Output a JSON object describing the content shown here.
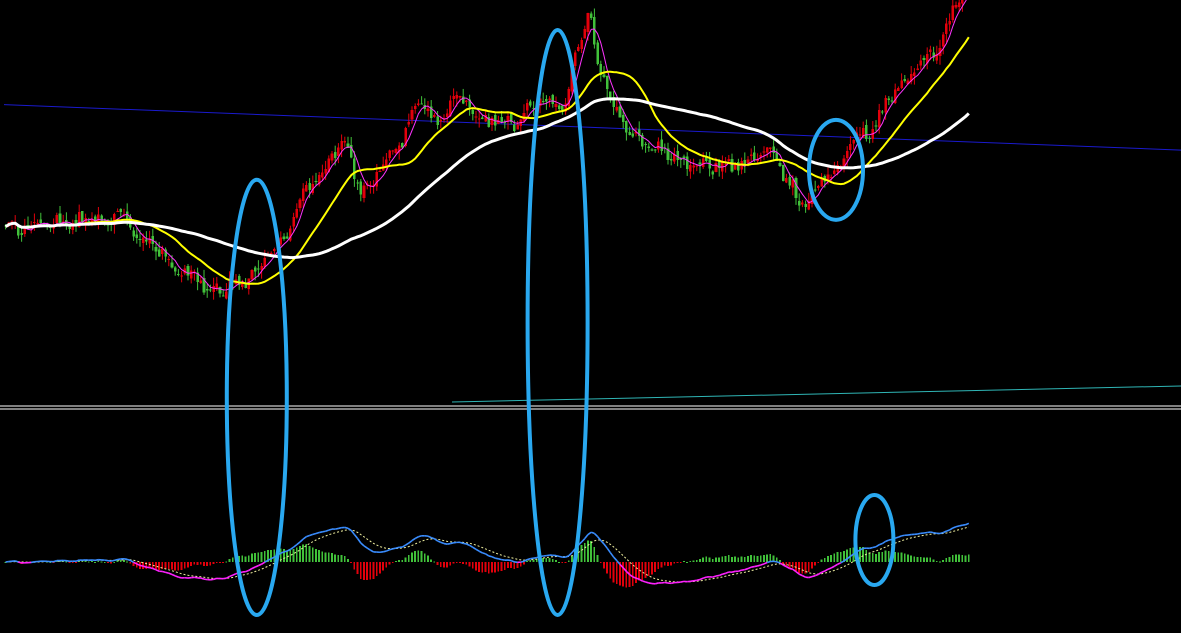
{
  "colors": {
    "background": "#000000",
    "up": "#e3000b",
    "down": "#41c13a",
    "ma_fast": "#ff33ff",
    "ma_mid": "#ffff00",
    "ma_slow": "#ffffff",
    "trendline_top": "#1a1acd",
    "trendline_bottom": "#2fb5b5",
    "separator": "#ffffff",
    "diff_line": "#3a8dff",
    "diff_line_below": "#ff22ff",
    "dea_line": "#f0f0a0",
    "highlight": "#29a8f0"
  },
  "chart_data": [
    {
      "type": "candlestick",
      "panel": "price",
      "title": "",
      "xlabel": "",
      "ylabel": "",
      "grid": false,
      "ylim": [
        0,
        100
      ],
      "anchors": [
        [
          0,
          42
        ],
        [
          20,
          44
        ],
        [
          35,
          45
        ],
        [
          45,
          38
        ],
        [
          55,
          31
        ],
        [
          65,
          27
        ],
        [
          75,
          29
        ],
        [
          85,
          38
        ],
        [
          95,
          53
        ],
        [
          105,
          63
        ],
        [
          112,
          52
        ],
        [
          122,
          63
        ],
        [
          130,
          75
        ],
        [
          135,
          68
        ],
        [
          140,
          76
        ],
        [
          150,
          70
        ],
        [
          158,
          69
        ],
        [
          168,
          75
        ],
        [
          175,
          74
        ],
        [
          178,
          87
        ],
        [
          182,
          96
        ],
        [
          186,
          82
        ],
        [
          190,
          73
        ],
        [
          195,
          66
        ],
        [
          205,
          62
        ],
        [
          215,
          58
        ],
        [
          225,
          58
        ],
        [
          240,
          61
        ],
        [
          245,
          54
        ],
        [
          248,
          48
        ],
        [
          252,
          51
        ],
        [
          258,
          57
        ],
        [
          268,
          66
        ],
        [
          280,
          78
        ],
        [
          290,
          87
        ],
        [
          298,
          99
        ],
        [
          302,
          106
        ]
      ],
      "n_bars": 302,
      "moving_averages": [
        {
          "name": "",
          "color_key": "ma_fast",
          "period": 5
        },
        {
          "name": "",
          "color_key": "ma_mid",
          "period": 20
        },
        {
          "name": "",
          "color_key": "ma_slow",
          "period": 60
        }
      ],
      "trendlines": [
        {
          "color_key": "trendline_top",
          "from": [
            0,
            73.5
          ],
          "to": [
            302,
            62
          ]
        },
        {
          "color_key": "trendline_bottom",
          "from": [
            140,
            0
          ],
          "to": [
            302,
            4
          ]
        }
      ]
    },
    {
      "type": "macd",
      "panel": "indicator",
      "title": "",
      "xlabel": "",
      "ylabel": "",
      "grid": false,
      "zero_line": true,
      "series": [
        {
          "name": "",
          "color_key": "diff_line"
        },
        {
          "name": "",
          "color_key": "dea_line",
          "style": "dashed"
        },
        {
          "name": "",
          "kind": "histogram"
        }
      ]
    }
  ],
  "annotations": {
    "highlights": [
      {
        "label": "",
        "bar_index": 79,
        "span": "both-panels"
      },
      {
        "label": "",
        "bar_index": 173,
        "span": "both-panels"
      },
      {
        "label": "",
        "bar_index": 260,
        "span": "price"
      },
      {
        "label": "",
        "bar_index": 272,
        "span": "indicator"
      }
    ]
  }
}
